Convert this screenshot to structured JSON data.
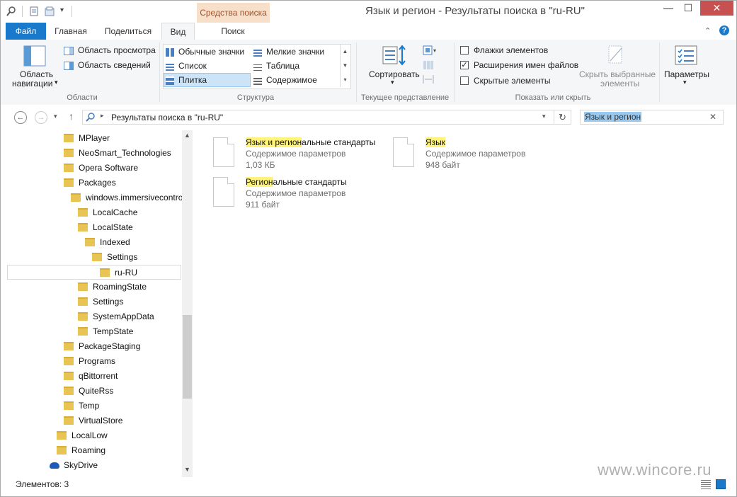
{
  "window": {
    "title": "Язык и регион - Результаты поиска в \"ru-RU\"",
    "context_tab_header": "Средства поиска",
    "minimize": "—",
    "maximize": "☐",
    "close": "✕"
  },
  "tabs": {
    "file": "Файл",
    "home": "Главная",
    "share": "Поделиться",
    "view": "Вид",
    "search": "Поиск"
  },
  "ribbon": {
    "panes": {
      "nav_pane_label_1": "Область",
      "nav_pane_label_2": "навигации",
      "preview_pane": "Область просмотра",
      "details_pane": "Область сведений",
      "group": "Области"
    },
    "layout": {
      "items": [
        "Обычные значки",
        "Мелкие значки",
        "Список",
        "Таблица",
        "Плитка",
        "Содержимое"
      ],
      "group": "Структура"
    },
    "current_view": {
      "sort": "Сортировать",
      "group": "Текущее представление"
    },
    "show_hide": {
      "item_checkboxes": "Флажки элементов",
      "file_extensions": "Расширения имен файлов",
      "hidden_items": "Скрытые элементы",
      "hide_selected_1": "Скрыть выбранные",
      "hide_selected_2": "элементы",
      "group": "Показать или скрыть",
      "checked": {
        "item_checkboxes": false,
        "file_extensions": true,
        "hidden_items": false
      }
    },
    "options": {
      "label": "Параметры"
    }
  },
  "address": {
    "path": "Результаты поиска в \"ru-RU\"",
    "search_value": "Язык и регион"
  },
  "tree": [
    {
      "label": "MPlayer",
      "level": 2
    },
    {
      "label": "NeoSmart_Technologies",
      "level": 2
    },
    {
      "label": "Opera Software",
      "level": 2
    },
    {
      "label": "Packages",
      "level": 2
    },
    {
      "label": "windows.immersivecontro",
      "level": 3
    },
    {
      "label": "LocalCache",
      "level": 4
    },
    {
      "label": "LocalState",
      "level": 4
    },
    {
      "label": "Indexed",
      "level": 5
    },
    {
      "label": "Settings",
      "level": 6
    },
    {
      "label": "ru-RU",
      "level": 7,
      "selected": true
    },
    {
      "label": "RoamingState",
      "level": 4
    },
    {
      "label": "Settings",
      "level": 4
    },
    {
      "label": "SystemAppData",
      "level": 4
    },
    {
      "label": "TempState",
      "level": 4
    },
    {
      "label": "PackageStaging",
      "level": 2
    },
    {
      "label": "Programs",
      "level": 2
    },
    {
      "label": "qBittorrent",
      "level": 2
    },
    {
      "label": "QuiteRss",
      "level": 2
    },
    {
      "label": "Temp",
      "level": 2
    },
    {
      "label": "VirtualStore",
      "level": 2
    },
    {
      "label": "LocalLow",
      "level": 1
    },
    {
      "label": "Roaming",
      "level": 1
    },
    {
      "label": "SkyDrive",
      "level": 0
    }
  ],
  "results": [
    {
      "name_hl": "Язык и регион",
      "name_rest": "альные стандарты",
      "type": "Содержимое параметров",
      "size": "1,03 КБ"
    },
    {
      "name_hl": "Язык",
      "name_rest": "",
      "type": "Содержимое параметров",
      "size": "948 байт"
    },
    {
      "name_hl": "Регион",
      "name_rest": "альные стандарты",
      "type": "Содержимое параметров",
      "size": "911 байт"
    }
  ],
  "status": {
    "items": "Элементов: 3"
  },
  "watermark": "www.wincore.ru",
  "colors": {
    "accent": "#1979ca",
    "context_tab": "#f7dfc9",
    "highlight": "#fff37a",
    "folder": "#e8c454"
  }
}
